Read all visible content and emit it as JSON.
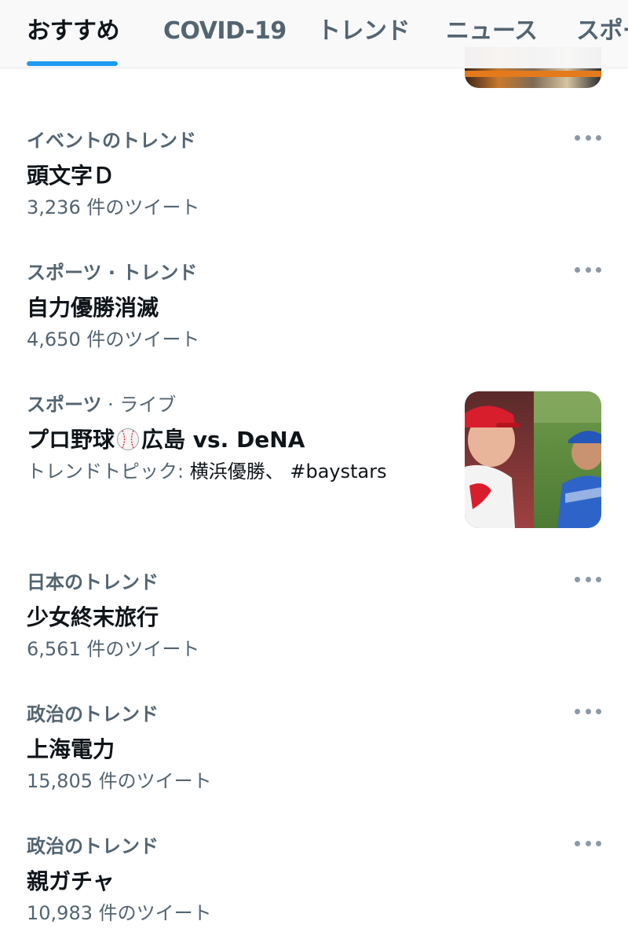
{
  "tabs": [
    {
      "label": "おすすめ",
      "active": true
    },
    {
      "label": "COVID-19",
      "active": false
    },
    {
      "label": "トレンド",
      "active": false
    },
    {
      "label": "ニュース",
      "active": false
    },
    {
      "label": "スポー",
      "active": false
    }
  ],
  "colors": {
    "accent": "#1d9bf0",
    "text_primary": "#0f1419",
    "text_secondary": "#536471"
  },
  "trends": [
    {
      "context": "イベントのトレンド",
      "title": "頭文字Ｄ",
      "count": "3,236 件のツイート"
    },
    {
      "context": "スポーツ · トレンド",
      "title": "自力優勝消滅",
      "count": "4,650 件のツイート"
    },
    {
      "context": "スポーツ",
      "context_suffix": " · ライブ",
      "title_prefix": "プロ野球",
      "title_icon": "baseball-icon",
      "title_suffix": "広島 vs. DeNA",
      "topics_label": "トレンドトピック: ",
      "topics": "横浜優勝、 #baystars"
    },
    {
      "context": "日本のトレンド",
      "title": "少女終末旅行",
      "count": "6,561 件のツイート"
    },
    {
      "context": "政治のトレンド",
      "title": "上海電力",
      "count": "15,805 件のツイート"
    },
    {
      "context": "政治のトレンド",
      "title": "親ガチャ",
      "count": "10,983 件のツイート"
    }
  ],
  "icons": {
    "more": "more-horizontal-icon",
    "baseball": "baseball-icon"
  }
}
